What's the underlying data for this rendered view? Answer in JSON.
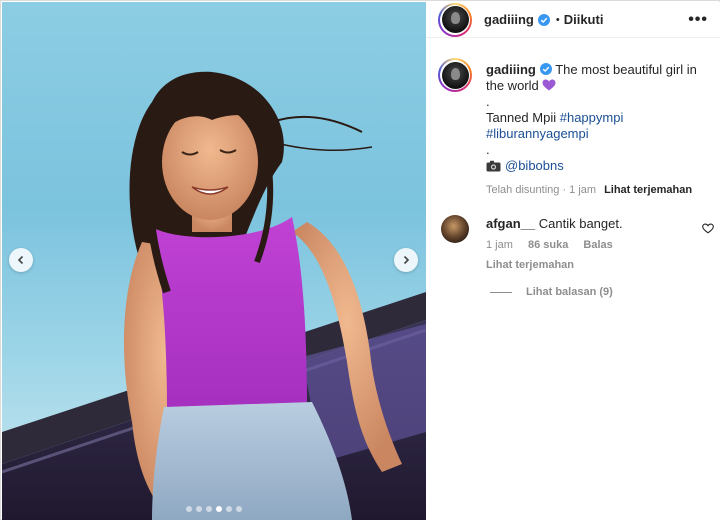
{
  "post": {
    "photo": {
      "carousel_dots": 6,
      "active_dot": 4
    }
  },
  "header": {
    "username": "gadiiing",
    "separator": "•",
    "follow_status": "Diikuti",
    "more": "•••"
  },
  "caption": {
    "username": "gadiiing",
    "line1": "The most beautiful girl in the world",
    "dot1": ".",
    "text2": "Tanned Mpii",
    "tag1": "#happympi",
    "tag2": "#liburannyagempi",
    "dot2": ".",
    "mention": "@bibobns",
    "edited": "Telah disunting · 1 jam",
    "translate": "Lihat terjemahan"
  },
  "comment": {
    "username": "afgan__",
    "text": "Cantik banget.",
    "time": "1 jam",
    "likes": "86 suka",
    "reply": "Balas",
    "translate": "Lihat terjemahan",
    "view_replies": "Lihat balasan (9)"
  },
  "colors": {
    "link": "#1b4f96",
    "verified": "#3897f0",
    "muted": "#8e8e8e"
  }
}
